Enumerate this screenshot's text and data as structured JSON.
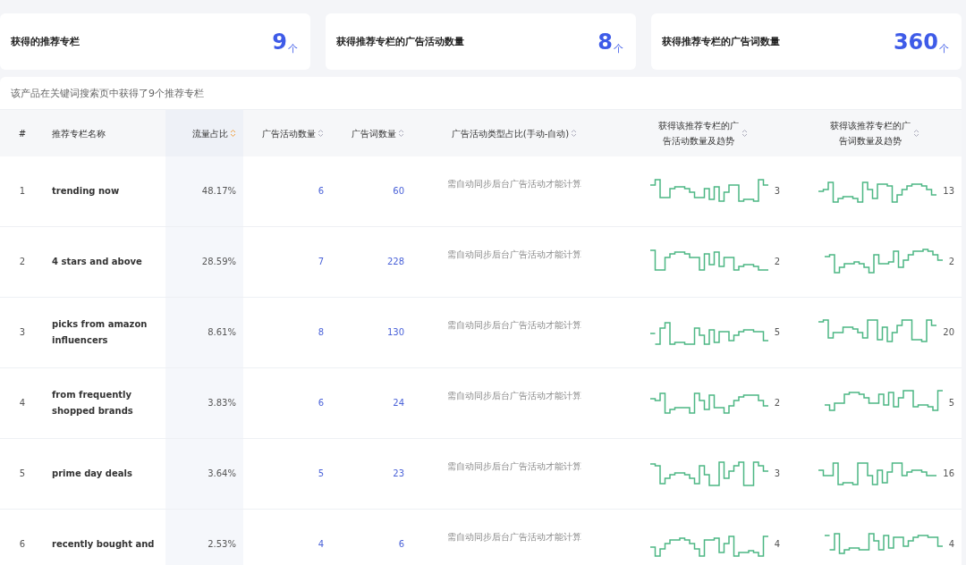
{
  "summary_cards": [
    {
      "label": "获得的推荐专栏",
      "value": "9",
      "unit": "个"
    },
    {
      "label": "获得推荐专栏的广告活动数量",
      "value": "8",
      "unit": "个"
    },
    {
      "label": "获得推荐专栏的广告词数量",
      "value": "360",
      "unit": "个"
    }
  ],
  "table": {
    "caption": "该产品在关键词搜索页中获得了9个推荐专栏",
    "columns": [
      {
        "label": "#"
      },
      {
        "label": "推荐专栏名称"
      },
      {
        "label": "流量占比",
        "sorted": true
      },
      {
        "label": "广告活动数量",
        "sorted": false
      },
      {
        "label": "广告词数量",
        "sorted": false
      },
      {
        "label": "广告活动类型占比(手动-自动)",
        "sorted": false
      },
      {
        "label": "获得该推荐专栏的广告活动数量及趋势",
        "sorted": false
      },
      {
        "label": "获得该推荐专栏的广告词数量及趋势",
        "sorted": false
      }
    ],
    "rows": [
      {
        "index": "1",
        "name": "trending now",
        "traffic_share": "48.17%",
        "campaigns": "6",
        "keywords": "60",
        "campaign_type_share": "需自动同步后台广告活动才能计算",
        "campaign_trend_count": "3",
        "keyword_trend_count": "13"
      },
      {
        "index": "2",
        "name": "4 stars and above",
        "traffic_share": "28.59%",
        "campaigns": "7",
        "keywords": "228",
        "campaign_type_share": "需自动同步后台广告活动才能计算",
        "campaign_trend_count": "2",
        "keyword_trend_count": "2"
      },
      {
        "index": "3",
        "name": "picks from amazon influencers",
        "traffic_share": "8.61%",
        "campaigns": "8",
        "keywords": "130",
        "campaign_type_share": "需自动同步后台广告活动才能计算",
        "campaign_trend_count": "5",
        "keyword_trend_count": "20"
      },
      {
        "index": "4",
        "name": "from frequently shopped brands",
        "traffic_share": "3.83%",
        "campaigns": "6",
        "keywords": "24",
        "campaign_type_share": "需自动同步后台广告活动才能计算",
        "campaign_trend_count": "2",
        "keyword_trend_count": "5"
      },
      {
        "index": "5",
        "name": "prime day deals",
        "traffic_share": "3.64%",
        "campaigns": "5",
        "keywords": "23",
        "campaign_type_share": "需自动同步后台广告活动才能计算",
        "campaign_trend_count": "3",
        "keyword_trend_count": "16"
      },
      {
        "index": "6",
        "name": "recently bought and",
        "traffic_share": "2.53%",
        "campaigns": "4",
        "keywords": "6",
        "campaign_type_share": "需自动同步后台广告活动才能计算",
        "campaign_trend_count": "4",
        "keyword_trend_count": "4"
      }
    ]
  }
}
